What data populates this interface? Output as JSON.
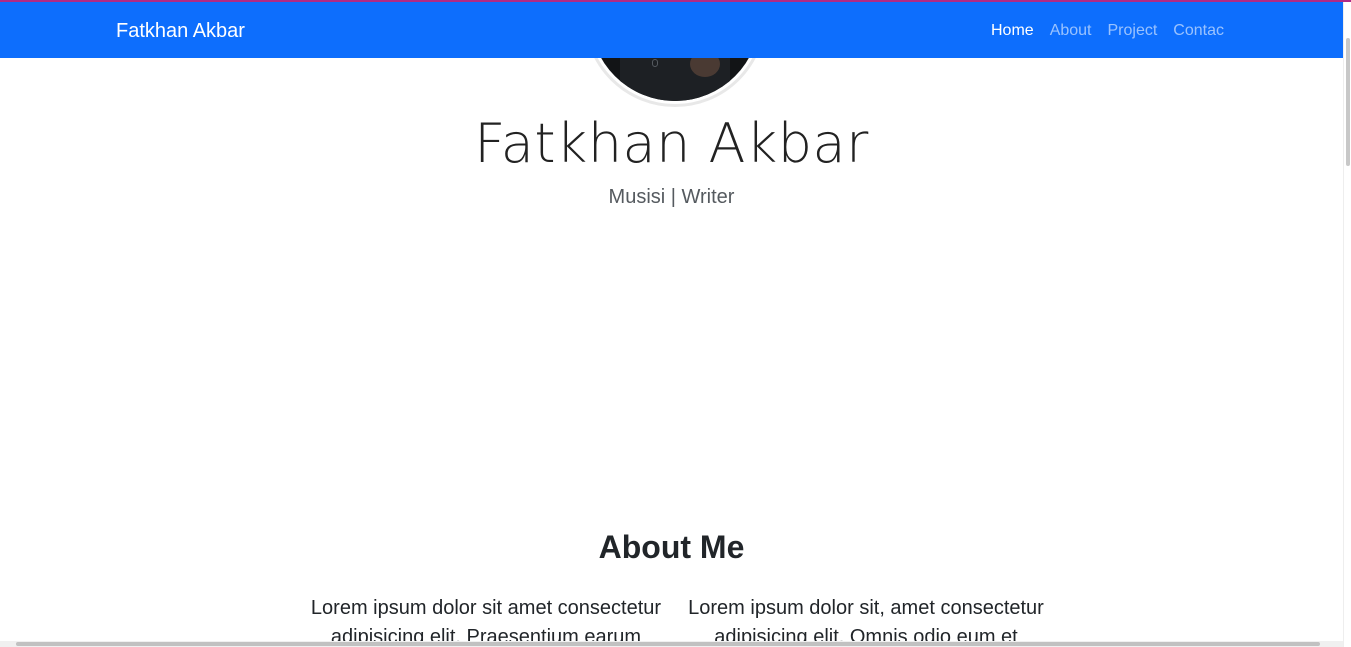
{
  "navbar": {
    "brand": "Fatkhan Akbar",
    "links": [
      {
        "label": "Home",
        "active": true
      },
      {
        "label": "About",
        "active": false
      },
      {
        "label": "Project",
        "active": false
      },
      {
        "label": "Contac",
        "active": false
      }
    ],
    "color": "#0d6efd"
  },
  "hero": {
    "name": "Fatkhan Akbar",
    "tagline": "Musisi | Writer"
  },
  "about": {
    "title": "About Me",
    "columns": [
      "Lorem ipsum dolor sit amet consectetur adipisicing elit. Praesentium earum",
      "Lorem ipsum dolor sit, amet consectetur adipisicing elit. Omnis odio eum et"
    ]
  }
}
